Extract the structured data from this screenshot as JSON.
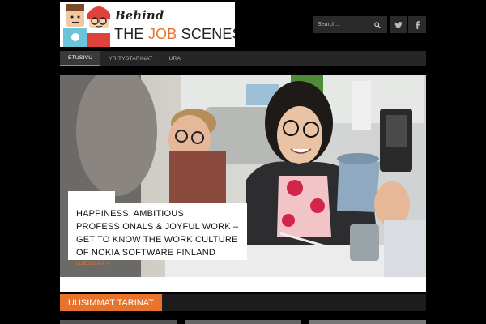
{
  "logo": {
    "behind": "Behind",
    "title_pre": "THE ",
    "title_accent": "JOB",
    "title_post": " SCENES"
  },
  "search": {
    "placeholder": "Search..."
  },
  "nav": {
    "items": [
      "ETUSIVU",
      "YRITYSTARINAT",
      "URA"
    ]
  },
  "hero": {
    "headline": "HAPPINESS, AMBITIOUS PROFESSIONALS & JOYFUL WORK – GET TO KNOW THE WORK CULTURE OF NOKIA SOFTWARE FINLAND",
    "read_more": "LUE LISÄÄ »"
  },
  "section": {
    "label": "UUSIMMAT TARINAT"
  },
  "colors": {
    "accent": "#e8732a",
    "background": "#000000",
    "nav": "#262626"
  },
  "icons": [
    "search-icon",
    "twitter-icon",
    "facebook-icon"
  ]
}
